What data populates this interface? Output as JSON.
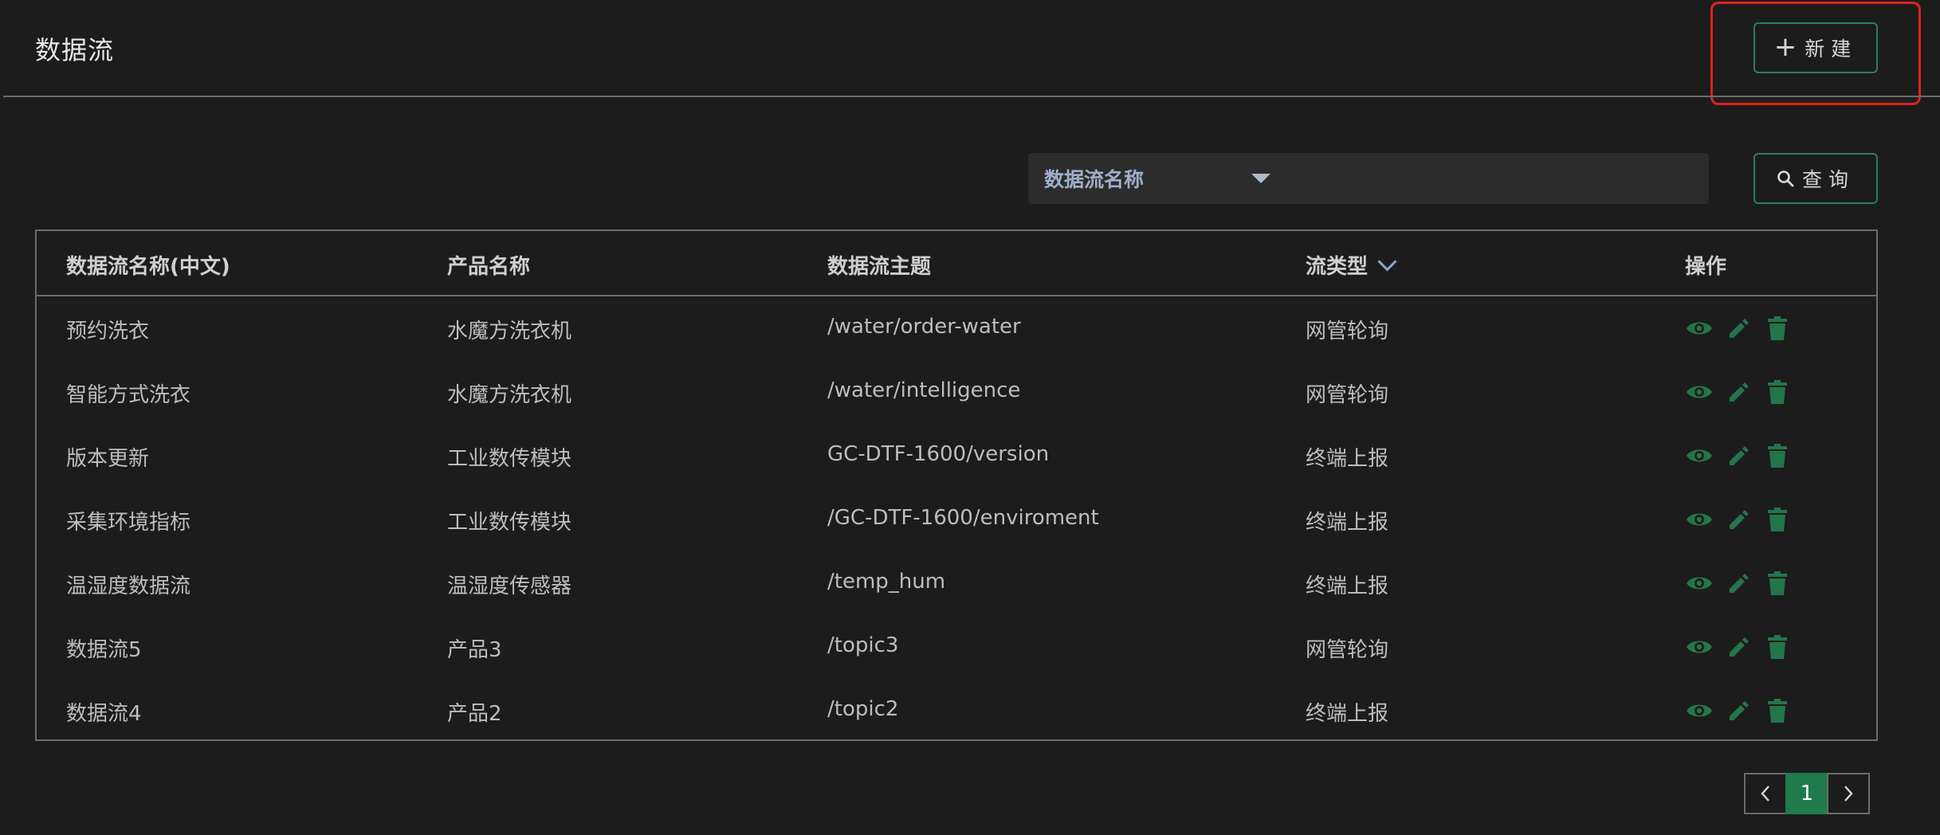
{
  "header": {
    "title": "数据流",
    "new_button": {
      "icon": "plus-icon",
      "label": "新建"
    }
  },
  "filter": {
    "field_select": {
      "value": "数据流名称"
    },
    "search_button": {
      "icon": "search-icon",
      "label": "查询"
    }
  },
  "table": {
    "columns": [
      "数据流名称(中文)",
      "产品名称",
      "数据流主题",
      "流类型",
      "操作"
    ],
    "sortable_column_icon": "chevron-down-icon",
    "rows": [
      [
        "预约洗衣",
        "水魔方洗衣机",
        "/water/order-water",
        "网管轮询"
      ],
      [
        "智能方式洗衣",
        "水魔方洗衣机",
        "/water/intelligence",
        "网管轮询"
      ],
      [
        "版本更新",
        "工业数传模块",
        "GC-DTF-1600/version",
        "终端上报"
      ],
      [
        "采集环境指标",
        "工业数传模块",
        "/GC-DTF-1600/enviroment",
        "终端上报"
      ],
      [
        "温湿度数据流",
        "温湿度传感器",
        "/temp_hum",
        "终端上报"
      ],
      [
        "数据流5",
        "产品3",
        "/topic3",
        "网管轮询"
      ],
      [
        "数据流4",
        "产品2",
        "/topic2",
        "终端上报"
      ]
    ],
    "row_actions": [
      "eye-icon",
      "pencil-icon",
      "trash-icon"
    ]
  },
  "pagination": {
    "prev_icon": "chevron-left-icon",
    "current_page": "1",
    "next_icon": "chevron-right-icon"
  },
  "colors": {
    "background": "#1c1c1d",
    "accent_green": "#1f7a4c",
    "action_icon_green": "#23764a",
    "highlight_red": "#e0231c"
  }
}
